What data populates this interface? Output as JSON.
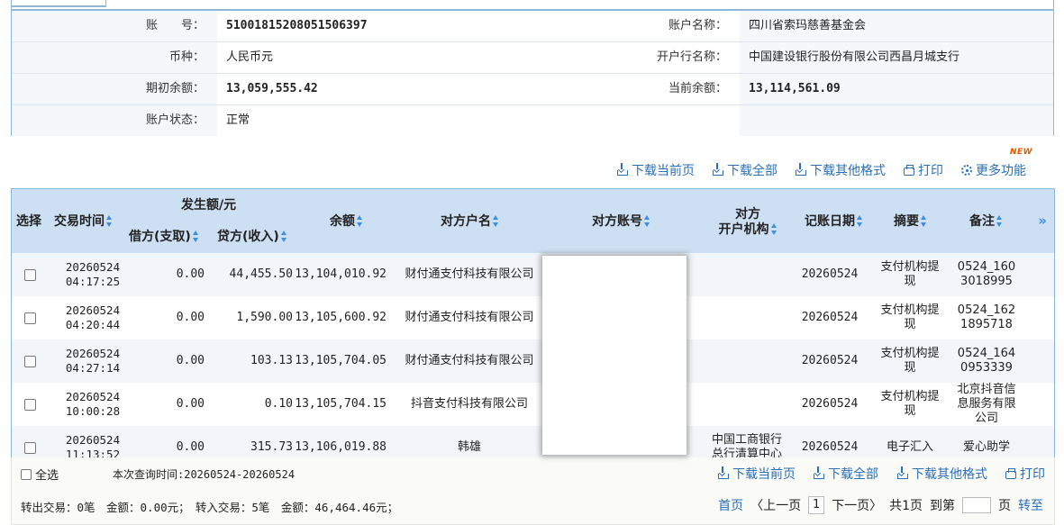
{
  "account_info": {
    "account_no_label": "账　　号：",
    "account_no": "51001815208051506397",
    "account_name_label": "账户名称：",
    "account_name": "四川省索玛慈善基金会",
    "currency_label": "币种：",
    "currency": "人民币元",
    "bank_label": "开户行名称：",
    "bank": "中国建设银行股份有限公司西昌月城支行",
    "opening_balance_label": "期初余额：",
    "opening_balance": "13,059,555.42",
    "current_balance_label": "当前余额：",
    "current_balance": "13,114,561.09",
    "status_label": "账户状态：",
    "status": "正常"
  },
  "toolbar": {
    "new_badge": "NEW",
    "download_current": "下载当前页",
    "download_all": "下载全部",
    "download_other": "下载其他格式",
    "print": "打印",
    "more": "更多功能"
  },
  "table": {
    "headers": {
      "select": "选择",
      "time": "交易时间",
      "amount_group": "发生额/元",
      "debit": "借方(支取)",
      "credit": "贷方(收入)",
      "balance": "余额",
      "counterparty_name": "对方户名",
      "counterparty_account": "对方账号",
      "counterparty_bank_1": "对方",
      "counterparty_bank_2": "开户机构",
      "post_date": "记账日期",
      "summary": "摘要",
      "remark": "备注",
      "more": "»"
    },
    "rows": [
      {
        "date": "20260524",
        "time": "04:17:25",
        "debit": "0.00",
        "credit": "44,455.50",
        "balance": "13,104,010.92",
        "cp_name": "财付通支付科技有限公司",
        "cp_bank": "",
        "post_date": "20260524",
        "summary": "支付机构提现",
        "remark": "0524_1603018995"
      },
      {
        "date": "20260524",
        "time": "04:20:44",
        "debit": "0.00",
        "credit": "1,590.00",
        "balance": "13,105,600.92",
        "cp_name": "财付通支付科技有限公司",
        "cp_bank": "",
        "post_date": "20260524",
        "summary": "支付机构提现",
        "remark": "0524_1621895718"
      },
      {
        "date": "20260524",
        "time": "04:27:14",
        "debit": "0.00",
        "credit": "103.13",
        "balance": "13,105,704.05",
        "cp_name": "财付通支付科技有限公司",
        "cp_bank": "",
        "post_date": "20260524",
        "summary": "支付机构提现",
        "remark": "0524_1640953339"
      },
      {
        "date": "20260524",
        "time": "10:00:28",
        "debit": "0.00",
        "credit": "0.10",
        "balance": "13,105,704.15",
        "cp_name": "抖音支付科技有限公司",
        "cp_bank": "",
        "post_date": "20260524",
        "summary": "支付机构提现",
        "remark": "北京抖音信息服务有限公司"
      },
      {
        "date": "20260524",
        "time": "11:13:52",
        "debit": "0.00",
        "credit": "315.73",
        "balance": "13,106,019.88",
        "cp_name": "韩雄",
        "cp_bank": "中国工商银行总行清算中心",
        "post_date": "20260524",
        "summary": "电子汇入",
        "remark": "爱心助学"
      }
    ]
  },
  "footer": {
    "select_all": "全选",
    "query_time": "本次查询时间:20260524-20260524",
    "download_current": "下载当前页",
    "download_all": "下载全部",
    "download_other": "下载其他格式",
    "print": "打印",
    "summary_line": "转出交易：0笔　金额：0.00元；　转入交易：5笔　金额：46,464.46元；",
    "first": "首页",
    "prev": "〈上一页",
    "current_page": "1",
    "next": "下一页〉",
    "total_pages": "共1页",
    "goto_label": "到第",
    "page_unit": "页",
    "go": "转至"
  }
}
